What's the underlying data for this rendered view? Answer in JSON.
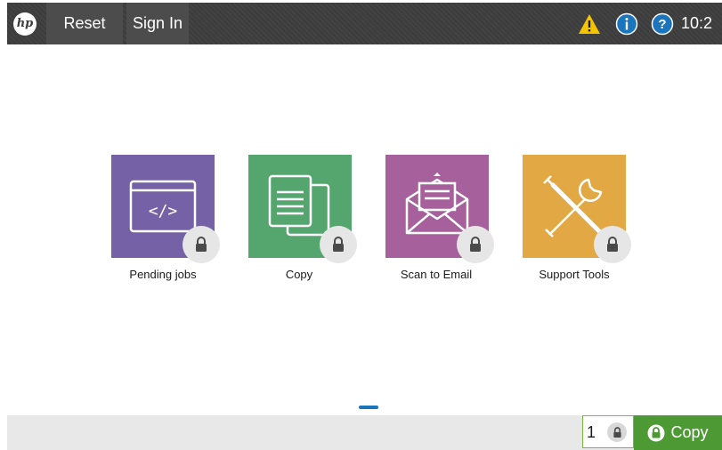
{
  "topbar": {
    "logo_text": "hp",
    "reset_label": "Reset",
    "signin_label": "Sign In",
    "time": "10:2"
  },
  "apps": [
    {
      "label": "Pending jobs",
      "color": "#7561a5",
      "icon": "embedded-code-icon",
      "locked": true
    },
    {
      "label": "Copy",
      "color": "#55a56f",
      "icon": "copy-documents-icon",
      "locked": true
    },
    {
      "label": "Scan to Email",
      "color": "#a6609b",
      "icon": "email-envelope-icon",
      "locked": true
    },
    {
      "label": "Support Tools",
      "color": "#e2a843",
      "icon": "tools-icon",
      "locked": true
    }
  ],
  "pager": {
    "current_page": 1,
    "total_pages": 1
  },
  "bottombar": {
    "copies": "1",
    "copy_label": "Copy",
    "copy_color": "#4d9a35"
  },
  "icons": {
    "warning": "warning-icon",
    "info": "info-icon",
    "help": "help-icon",
    "lock": "lock-icon"
  }
}
